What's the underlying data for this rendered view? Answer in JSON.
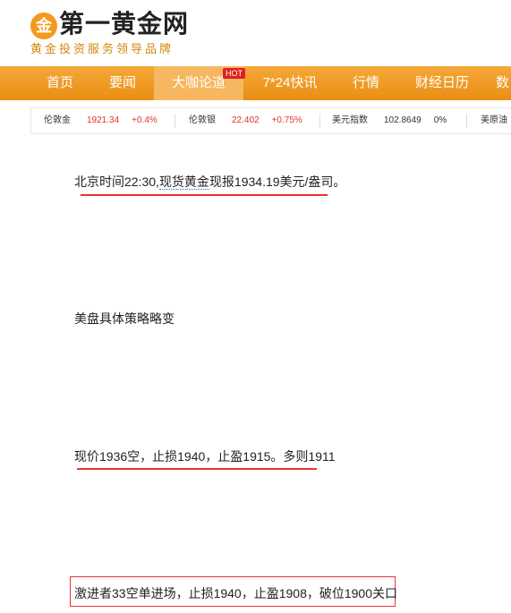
{
  "header": {
    "logo_glyph": "金",
    "site_name": "第一黄金网",
    "slogan": "黄金投资服务领导品牌"
  },
  "nav": {
    "items": [
      "首页",
      "要闻",
      "大咖论道",
      "7*24快讯",
      "行情",
      "财经日历",
      "数"
    ],
    "active_index": 2,
    "hot_badge": "HOT"
  },
  "ticker": [
    {
      "name": "伦敦金",
      "value": "1921.34",
      "change": "+0.4%"
    },
    {
      "name": "伦敦银",
      "value": "22.402",
      "change": "+0.75%"
    },
    {
      "name": "美元指数",
      "value": "102.8649",
      "change": "0%"
    },
    {
      "name": "美原油",
      "value": "",
      "change": ""
    }
  ],
  "article": {
    "line1_prefix": "北京时间22:30,",
    "line1_link": "现货黄金",
    "line1_suffix": "现报1934.19美元/盎司。",
    "line2": "美盘具体策略略变",
    "line3": "现价1936空，止损1940，止盈1915。多则1911",
    "line4": "激进者33空单进场，止损1940，止盈1908，破位1900关口"
  },
  "colors": {
    "nav_bg": "#ef9a22",
    "accent_red": "#e33333",
    "brand_orange": "#f39a1e"
  }
}
